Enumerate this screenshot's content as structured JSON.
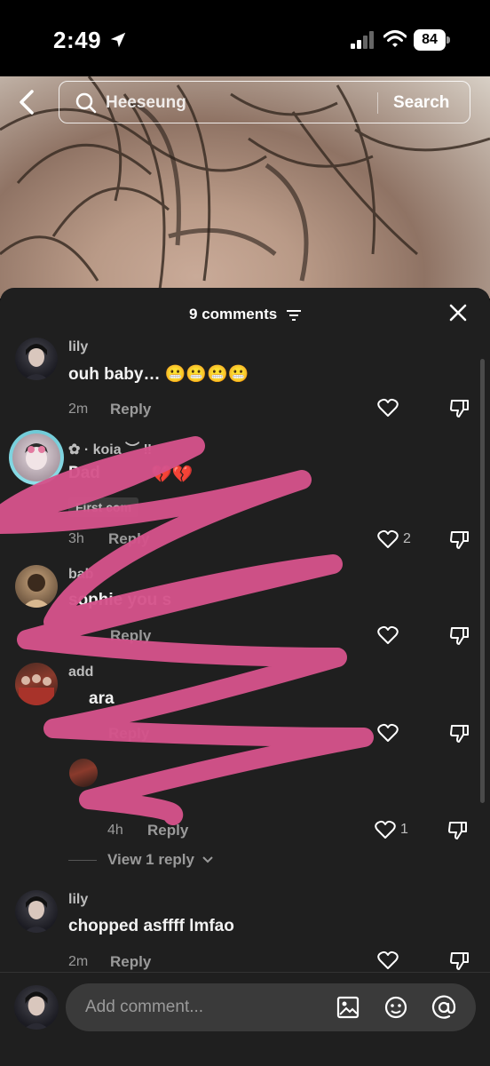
{
  "status": {
    "time": "2:49",
    "battery": "84"
  },
  "search": {
    "query": "Heeseung",
    "button": "Search"
  },
  "sheet": {
    "title": "9 comments"
  },
  "comments": [
    {
      "user": "lily",
      "text": "ouh baby… 😬😬😬😬",
      "time": "2m",
      "reply": "Reply"
    },
    {
      "user": "✿ · koia ︶ ‼",
      "text": "Dad",
      "hearts": "💔💔",
      "badge": "First com",
      "time": "3h",
      "reply": "Reply",
      "likes": "2"
    },
    {
      "user": "bab",
      "text": "sophie you s",
      "reply": "Reply"
    },
    {
      "user": "add",
      "text": "ara",
      "reply": "Reply"
    },
    {
      "time": "4h",
      "reply": "Reply",
      "likes": "1"
    },
    {
      "user": "lily",
      "text": "chopped asffff lmfao",
      "time": "2m",
      "reply": "Reply"
    }
  ],
  "view_reply": "View 1 reply",
  "composer": {
    "placeholder": "Add comment..."
  },
  "colors": {
    "scribble": "#d4528a",
    "sheet": "#1f1f1f",
    "ring": "#6fc9d6"
  },
  "icons": [
    "location-arrow-icon",
    "signal-icon",
    "wifi-icon",
    "back-chevron-icon",
    "search-icon",
    "filter-icon",
    "close-icon",
    "heart-icon",
    "dislike-icon",
    "image-icon",
    "emoji-icon",
    "at-icon"
  ]
}
